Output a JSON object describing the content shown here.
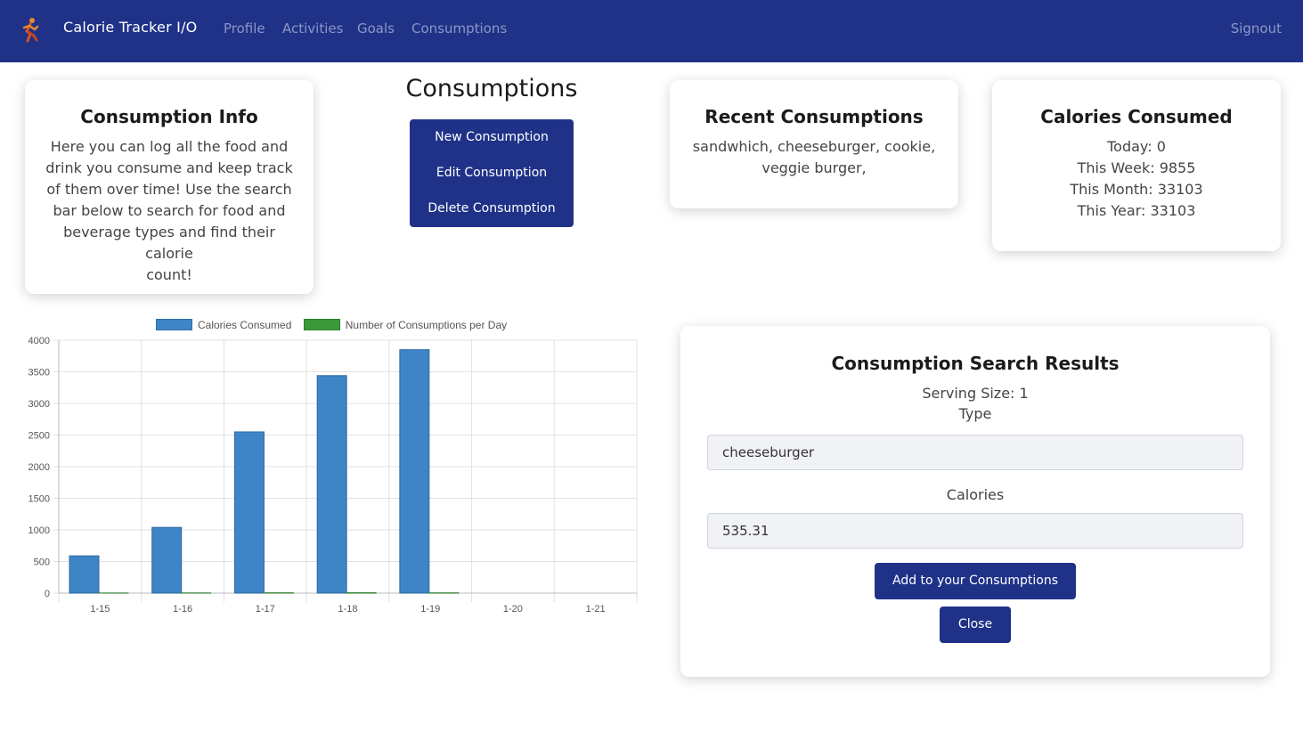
{
  "navbar": {
    "brand": "Calorie Tracker I/O",
    "links": [
      "Profile",
      "Activities",
      "Goals",
      "Consumptions"
    ],
    "signout": "Signout"
  },
  "info_card": {
    "title": "Consumption Info",
    "lines": [
      "Here you can log all the food and",
      "drink you consume and keep track",
      "of them over time! Use the search",
      "bar below to search for food and",
      "beverage types and find their calorie",
      "count!"
    ]
  },
  "consumptions": {
    "title": "Consumptions",
    "buttons": [
      "New Consumption",
      "Edit Consumption",
      "Delete Consumption"
    ]
  },
  "recent_card": {
    "title": "Recent Consumptions",
    "lines": [
      "sandwhich, cheeseburger, cookie,",
      "veggie burger,"
    ]
  },
  "calories_card": {
    "title": "Calories Consumed",
    "lines": [
      "Today: 0",
      "This Week: 9855",
      "This Month: 33103",
      "This Year: 33103"
    ]
  },
  "search_card": {
    "title": "Consumption Search Results",
    "serving_size": "Serving Size: 1",
    "type_label": "Type",
    "type_value": "cheeseburger",
    "calories_label": "Calories",
    "calories_value": "535.31",
    "add_button": "Add to your Consumptions",
    "close_button": "Close"
  },
  "colors": {
    "navbar": "#1f3288",
    "primary": "#1f3288",
    "calories_bar": "#3d85c6",
    "consumptions_bar": "#3a9a3a"
  },
  "chart_data": {
    "type": "bar",
    "categories": [
      "1-15",
      "1-16",
      "1-17",
      "1-18",
      "1-19",
      "1-20",
      "1-21"
    ],
    "series": [
      {
        "name": "Calories Consumed",
        "values": [
          590,
          1040,
          2550,
          3440,
          3850,
          0,
          0
        ]
      },
      {
        "name": "Number of Consumptions per Day",
        "values": [
          2,
          3,
          5,
          6,
          4,
          0,
          0
        ]
      }
    ],
    "ylim": [
      0,
      4000
    ],
    "yticks": [
      0,
      500,
      1000,
      1500,
      2000,
      2500,
      3000,
      3500,
      4000
    ],
    "grid": true,
    "legend": "top"
  }
}
